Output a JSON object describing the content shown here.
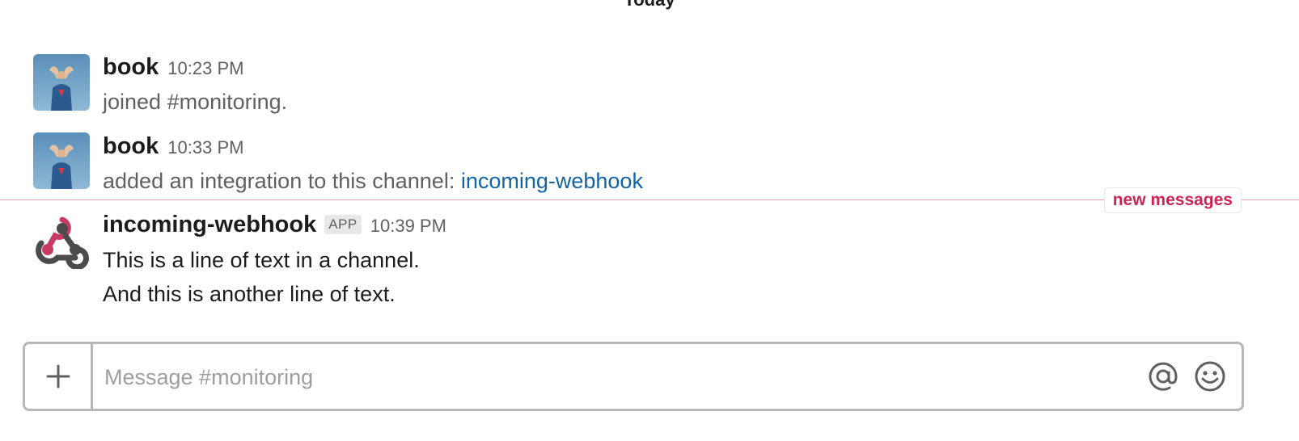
{
  "day_divider": {
    "label": "Today"
  },
  "messages": [
    {
      "sender": "book",
      "time": "10:23 PM",
      "lines": [
        "joined #monitoring."
      ]
    },
    {
      "sender": "book",
      "time": "10:33 PM",
      "text_prefix": "added an integration to this channel: ",
      "link_text": "incoming-webhook"
    },
    {
      "sender": "incoming-webhook",
      "badge": "APP",
      "time": "10:39 PM",
      "lines": [
        "This is a line of text in a channel.",
        "And this is another line of text."
      ]
    }
  ],
  "new_messages_label": "new messages",
  "composer": {
    "placeholder": "Message #monitoring",
    "attach_icon": "plus-icon",
    "mention_icon": "at-sign-icon",
    "emoji_icon": "smiley-icon"
  },
  "colors": {
    "link": "#1264a3",
    "new_messages": "#cd2553",
    "webhook_red": "#c73a63",
    "webhook_dark": "#4b4b4b"
  }
}
